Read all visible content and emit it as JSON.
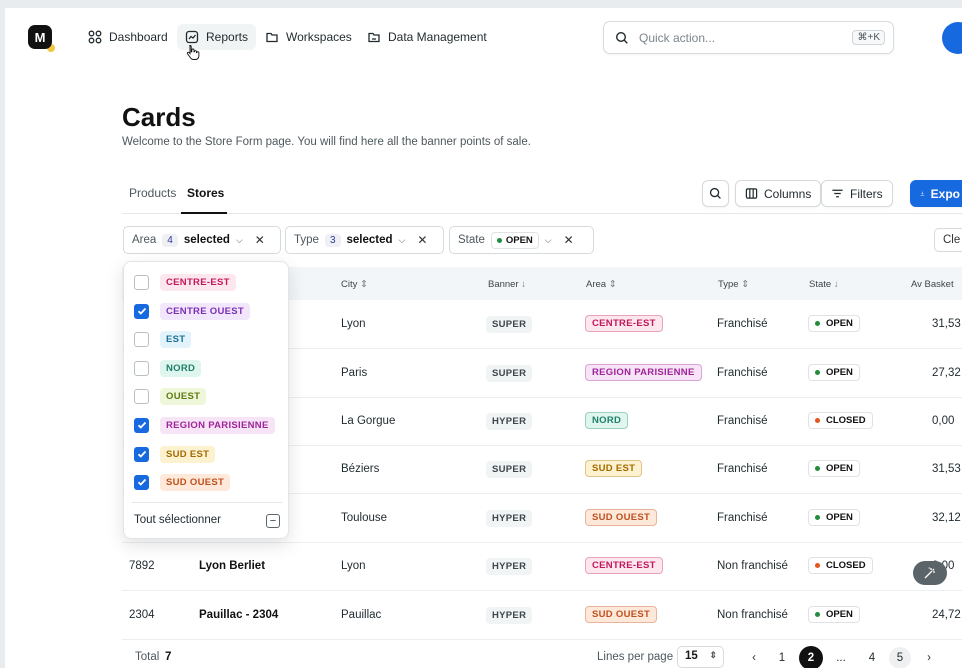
{
  "nav": {
    "logo_text": "M",
    "items": [
      {
        "label": "Dashboard"
      },
      {
        "label": "Reports"
      },
      {
        "label": "Workspaces"
      },
      {
        "label": "Data Management"
      }
    ],
    "quick_action": {
      "placeholder": "Quick action...",
      "shortcut": "⌘+K"
    }
  },
  "page": {
    "title": "Cards",
    "subtitle": "Welcome to the Store Form page. You will find here all the banner points of sale."
  },
  "tabs": [
    {
      "label": "Products"
    },
    {
      "label": "Stores"
    }
  ],
  "toolbar": {
    "columns_label": "Columns",
    "filters_label": "Filters",
    "export_label": "Expo"
  },
  "filters": {
    "area": {
      "label": "Area",
      "count": "4",
      "selected_text": "selected"
    },
    "type": {
      "label": "Type",
      "count": "3",
      "selected_text": "selected"
    },
    "state": {
      "label": "State",
      "value": "OPEN"
    },
    "clear_label": "Cle"
  },
  "area_dropdown": {
    "options": [
      {
        "label": "CENTRE-EST",
        "checked": false,
        "color": "#c2185b",
        "bg": "#fde7ef"
      },
      {
        "label": "CENTRE OUEST",
        "checked": true,
        "color": "#7b2fb5",
        "bg": "#f1e6fb"
      },
      {
        "label": "EST",
        "checked": false,
        "color": "#1b6f9a",
        "bg": "#e3f3fb"
      },
      {
        "label": "NORD",
        "checked": false,
        "color": "#1f7f6a",
        "bg": "#dff6ef"
      },
      {
        "label": "OUEST",
        "checked": false,
        "color": "#5d7a10",
        "bg": "#eef7d9"
      },
      {
        "label": "REGION PARISIENNE",
        "checked": true,
        "color": "#a0249a",
        "bg": "#f7e4f6"
      },
      {
        "label": "SUD EST",
        "checked": true,
        "color": "#a36a00",
        "bg": "#fdf2cf"
      },
      {
        "label": "SUD OUEST",
        "checked": true,
        "color": "#c0501d",
        "bg": "#fde8da"
      }
    ],
    "select_all_label": "Tout sélectionner"
  },
  "table": {
    "headers": {
      "city": "City",
      "banner": "Banner",
      "area": "Area",
      "type": "Type",
      "state": "State",
      "avbasket": "Av Basket"
    },
    "rows": [
      {
        "id": "",
        "name": "",
        "city": "Lyon",
        "banner": "SUPER",
        "area": "CENTRE-EST",
        "area_color": "#c2185b",
        "area_bg": "#fde7ef",
        "type": "Franchisé",
        "state": "OPEN",
        "state_color": "#1e8e3e",
        "avbasket": "31,53"
      },
      {
        "id": "",
        "name": "",
        "city": "Paris",
        "banner": "SUPER",
        "area": "REGION PARISIENNE",
        "area_color": "#a0249a",
        "area_bg": "#f7e4f6",
        "type": "Franchisé",
        "state": "OPEN",
        "state_color": "#1e8e3e",
        "avbasket": "27,32"
      },
      {
        "id": "",
        "name": "",
        "city": "La Gorgue",
        "banner": "HYPER",
        "area": "NORD",
        "area_color": "#1f7f6a",
        "area_bg": "#dff6ef",
        "type": "Franchisé",
        "state": "CLOSED",
        "state_color": "#e8531f",
        "avbasket": "0,00"
      },
      {
        "id": "",
        "name": "",
        "city": "Béziers",
        "banner": "SUPER",
        "area": "SUD EST",
        "area_color": "#a36a00",
        "area_bg": "#fdf2cf",
        "type": "Franchisé",
        "state": "OPEN",
        "state_color": "#1e8e3e",
        "avbasket": "31,53"
      },
      {
        "id": "",
        "name": "",
        "city": "Toulouse",
        "banner": "HYPER",
        "area": "SUD OUEST",
        "area_color": "#c0501d",
        "area_bg": "#fde8da",
        "type": "Franchisé",
        "state": "OPEN",
        "state_color": "#1e8e3e",
        "avbasket": "32,12"
      },
      {
        "id": "7892",
        "name": "Lyon Berliet",
        "city": "Lyon",
        "banner": "HYPER",
        "area": "CENTRE-EST",
        "area_color": "#c2185b",
        "area_bg": "#fde7ef",
        "type": "Non franchisé",
        "state": "CLOSED",
        "state_color": "#e8531f",
        "avbasket": "0,00"
      },
      {
        "id": "2304",
        "name": "Pauillac - 2304",
        "city": "Pauillac",
        "banner": "HYPER",
        "area": "SUD OUEST",
        "area_color": "#c0501d",
        "area_bg": "#fde8da",
        "type": "Non franchisé",
        "state": "OPEN",
        "state_color": "#1e8e3e",
        "avbasket": "24,72"
      }
    ]
  },
  "footer": {
    "total_label": "Total",
    "total_value": "7",
    "lines_per_page_label": "Lines per page",
    "lines_per_page_value": "15",
    "pages": [
      "1",
      "2",
      "...",
      "4",
      "5"
    ],
    "current_page": "2"
  }
}
